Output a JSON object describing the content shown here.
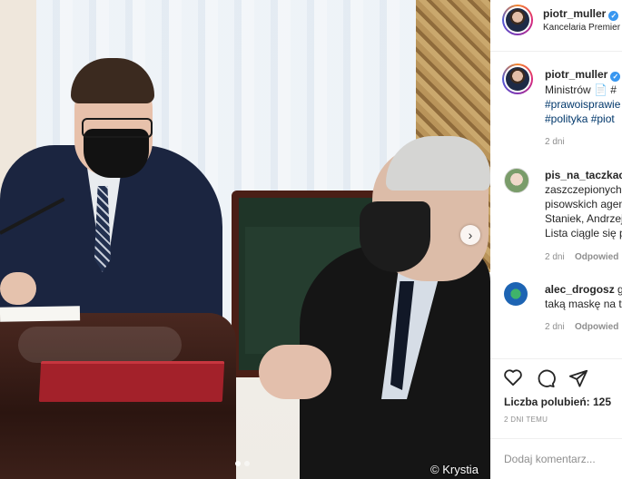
{
  "photo": {
    "credit": "© Krystia",
    "carousel_next": "›",
    "carousel_dots": 2
  },
  "header": {
    "username": "piotr_muller",
    "location": "Kancelaria Premier"
  },
  "caption": {
    "username": "piotr_muller",
    "line1": "Ministrów 📄 #",
    "line2": "#prawoisprawie",
    "line3": "#polityka #piot",
    "time": "2 dni"
  },
  "comments": [
    {
      "username": "pis_na_taczkach",
      "lines": [
        "zaszczepionych",
        "pisowskich agen",
        "Staniek, Andrzej",
        "Lista ciągle się p"
      ],
      "time": "2 dni",
      "reply": "Odpowied"
    },
    {
      "username": "alec_drogosz",
      "suffix": "g",
      "lines": [
        "taką maskę na t"
      ],
      "time": "2 dni",
      "reply": "Odpowied"
    }
  ],
  "likes_text": "Liczba polubień: 125",
  "posted": "2 DNI TEMU",
  "add_comment_placeholder": "Dodaj komentarz..."
}
